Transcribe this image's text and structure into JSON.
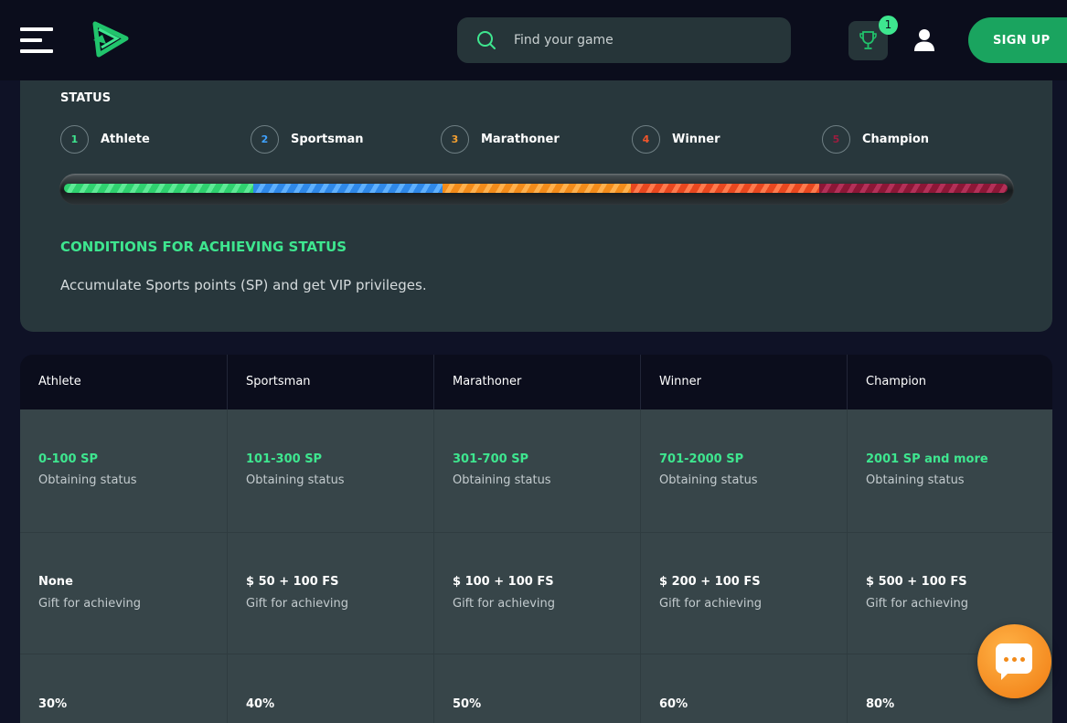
{
  "header": {
    "search": {
      "placeholder": "Find your game"
    },
    "trophy_count": "1",
    "signup_label": "SIGN UP"
  },
  "status": {
    "title": "STATUS",
    "levels": [
      {
        "number": "1",
        "name": "Athlete",
        "color": "#3ee68f"
      },
      {
        "number": "2",
        "name": "Sportsman",
        "color": "#3fa2ff"
      },
      {
        "number": "3",
        "name": "Marathoner",
        "color": "#f5a030"
      },
      {
        "number": "4",
        "name": "Winner",
        "color": "#f2552b"
      },
      {
        "number": "5",
        "name": "Champion",
        "color": "#9c1d3f"
      }
    ],
    "conditions_title": "CONDITIONS FOR ACHIEVING STATUS",
    "conditions_text": "Accumulate Sports points (SP) and get VIP privileges."
  },
  "table": {
    "headers": [
      "Athlete",
      "Sportsman",
      "Marathoner",
      "Winner",
      "Champion"
    ],
    "rows": [
      {
        "label": "Obtaining status",
        "values": [
          "0-100 SP",
          "101-300 SP",
          "301-700 SP",
          "701-2000 SP",
          "2001 SP and more"
        ]
      },
      {
        "label": "Gift for achieving",
        "values": [
          "None",
          "$ 50 + 100 FS",
          "$ 100 + 100 FS",
          "$ 200 + 100 FS",
          "$ 500 + 100 FS"
        ]
      },
      {
        "label": "",
        "values": [
          "30%",
          "40%",
          "50%",
          "60%",
          "80%"
        ]
      }
    ]
  },
  "colors": {
    "accent_green": "#3ee68f",
    "signup_green": "#1aa45f",
    "chat_orange": "#f28a18"
  }
}
